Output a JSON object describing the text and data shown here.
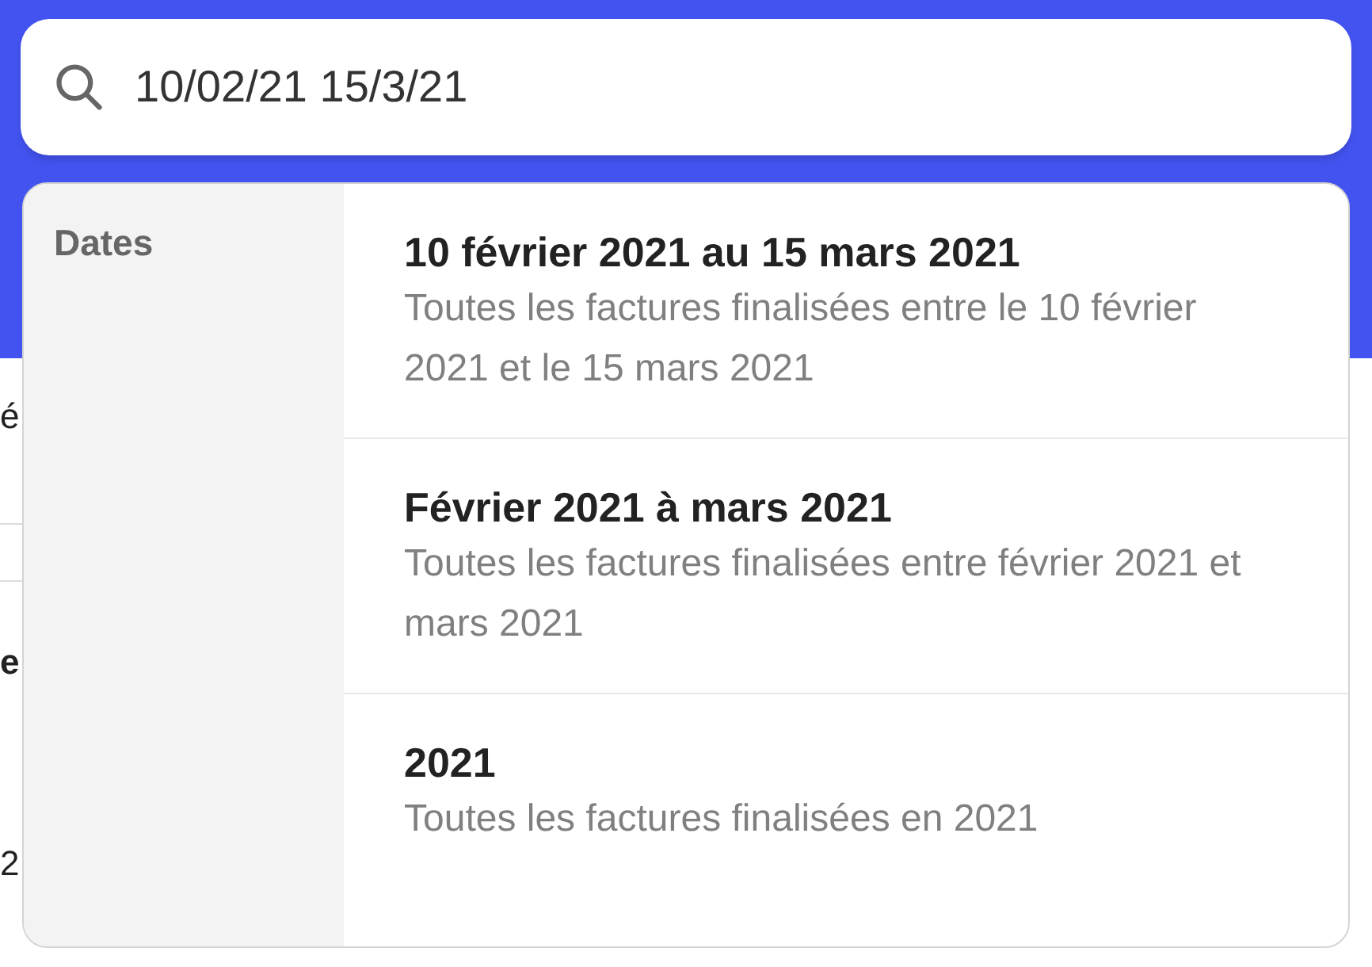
{
  "search": {
    "value": "10/02/21 15/3/21"
  },
  "background_fragments": [
    {
      "text": "é",
      "kind": "plain"
    },
    {
      "text": "e",
      "kind": "bold"
    },
    {
      "text": "2",
      "kind": "plain"
    }
  ],
  "dropdown": {
    "section_label": "Dates",
    "suggestions": [
      {
        "title": "10 février 2021 au 15 mars 2021",
        "description": "Toutes les factures finalisées entre le 10 février 2021 et le 15 mars 2021"
      },
      {
        "title": "Février 2021 à mars 2021",
        "description": "Toutes les factures finalisées entre février 2021 et mars 2021"
      },
      {
        "title": "2021",
        "description": "Toutes les factures finalisées en 2021"
      }
    ]
  }
}
